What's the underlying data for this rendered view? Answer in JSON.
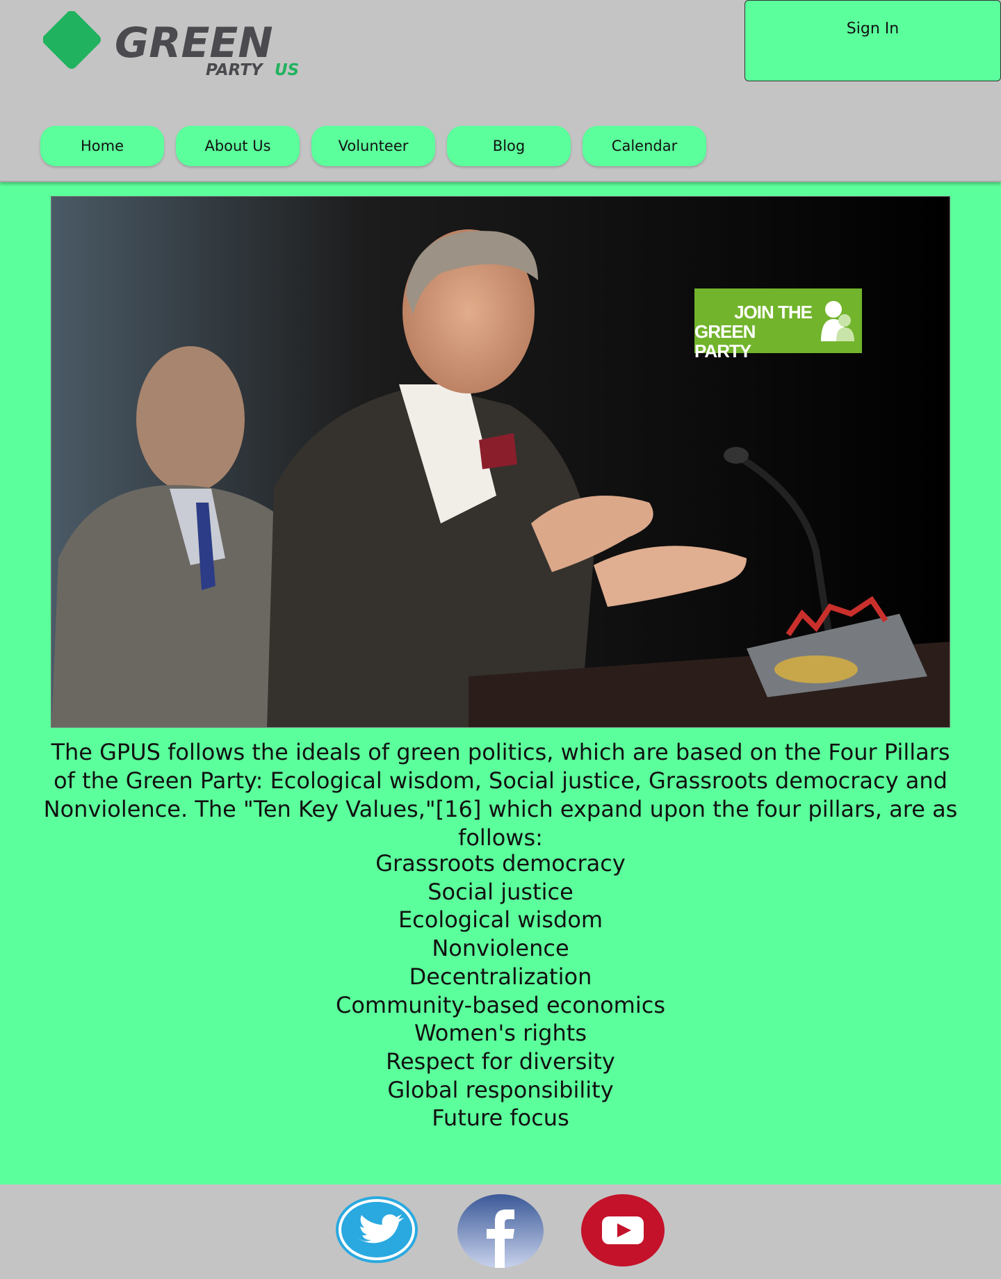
{
  "header": {
    "logo": {
      "icon": "green-diamond-logo-icon",
      "word": "GREEN",
      "sub": "PARTY",
      "country": "US"
    },
    "signin_label": "Sign In"
  },
  "nav": {
    "items": [
      {
        "label": "Home"
      },
      {
        "label": "About Us"
      },
      {
        "label": "Volunteer"
      },
      {
        "label": "Blog"
      },
      {
        "label": "Calendar"
      }
    ]
  },
  "hero": {
    "description_icon": "speaker-at-podium-photo",
    "join_banner": {
      "line1": "JOIN THE",
      "line2": "GREEN PARTY",
      "icon": "people-silhouette-icon"
    }
  },
  "content": {
    "intro": "The GPUS follows the ideals of green politics, which are based on the Four Pillars of the Green Party: Ecological wisdom, Social justice, Grassroots democracy and Nonviolence. The \"Ten Key Values,\"[16] which expand upon the four pillars, are as follows:",
    "values": [
      "Grassroots democracy",
      "Social justice",
      "Ecological wisdom",
      "Nonviolence",
      "Decentralization",
      "Community-based economics",
      "Women's rights",
      "Respect for diversity",
      "Global responsibility",
      "Future focus"
    ]
  },
  "footer": {
    "social": [
      {
        "name": "twitter-icon"
      },
      {
        "name": "facebook-icon"
      },
      {
        "name": "youtube-icon"
      }
    ]
  },
  "colors": {
    "accent": "#5bff9b",
    "background": "#c4c4c4",
    "logo_green": "#20b25e",
    "logo_gray": "#4a4a4f",
    "join_banner": "#72b42c",
    "twitter": "#2aa9e0",
    "facebook": "#3b5998",
    "youtube": "#c4122a"
  }
}
